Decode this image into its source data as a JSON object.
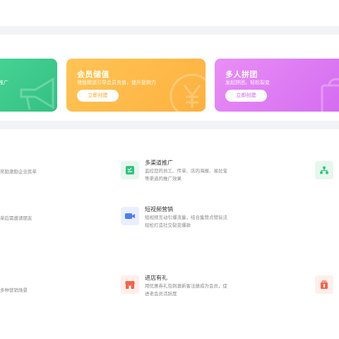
{
  "cards": [
    {
      "title": "",
      "desc": "推广",
      "button": "",
      "color": "#3ecb8c"
    },
    {
      "title": "会员储值",
      "desc": "储值赠送引导会员充值，提升复购力",
      "button": "立即创建",
      "color": "#fdb948",
      "button_text_color": "#f5a524"
    },
    {
      "title": "多人拼团",
      "desc": "发起拼团，轻松裂变",
      "button": "立即创建",
      "color": "#de7bf4",
      "button_text_color": "#c75ce6"
    }
  ],
  "left_descs": [
    "奖励激励企业民单",
    "单后需邀请朋友",
    "多种营销场景"
  ],
  "features": [
    {
      "title": "多渠道推广",
      "desc": "监控您的员工、传单、店内海报、易拉宝等渠道的推广效果",
      "icon": "list-check-icon"
    },
    {
      "title": "短视频营销",
      "desc": "短视频互动引爆流量，结合集赞点赞玩法轻松打造社交裂变爆款",
      "icon": "video-camera-icon"
    },
    {
      "title": "进店有礼",
      "desc": "用优惠券礼包刺激新客注册成为会员，促进老会员活跃度",
      "icon": "store-icon"
    }
  ],
  "right_icons": [
    "network-icon",
    "gift-store-icon"
  ]
}
